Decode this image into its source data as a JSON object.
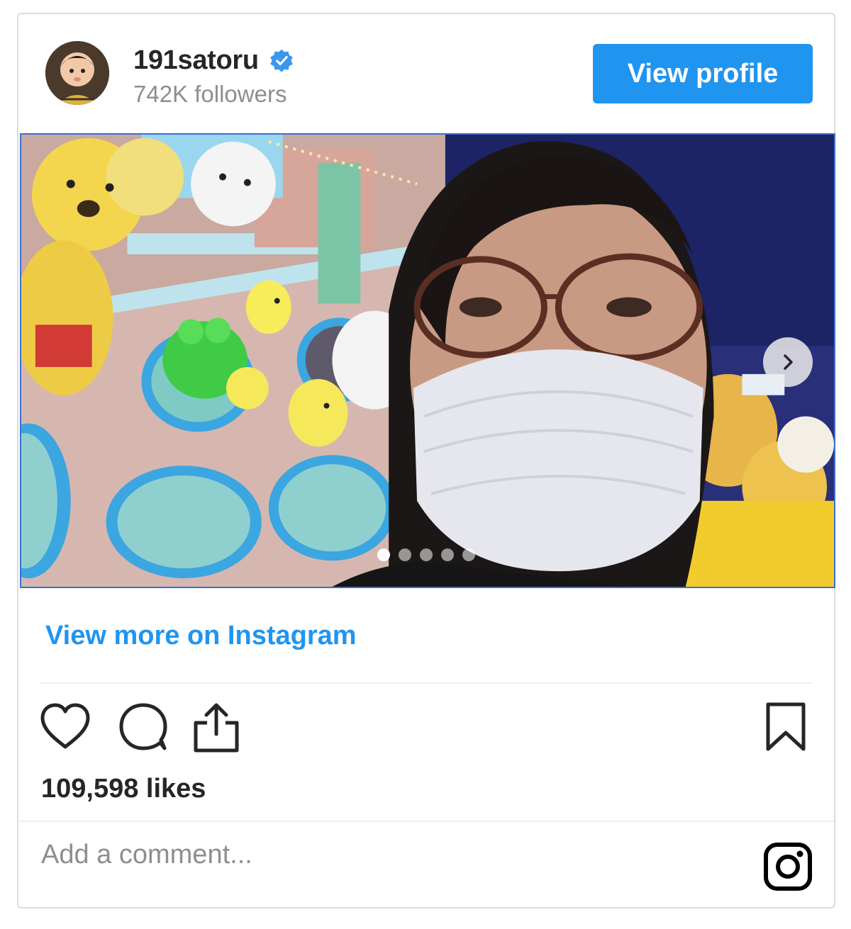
{
  "profile": {
    "username": "191satoru",
    "followers": "742K followers",
    "verified_icon": "verified-badge-icon",
    "view_profile_label": "View profile",
    "accent_color": "#1f95f0"
  },
  "media": {
    "next_icon": "chevron-right-icon",
    "carousel_total": 5,
    "carousel_active": 1
  },
  "post": {
    "view_more_label": "View more on Instagram",
    "likes": "109,598 likes",
    "comment_placeholder": "Add a comment...",
    "action_icons": [
      "heart-icon",
      "comment-icon",
      "share-icon",
      "bookmark-icon"
    ],
    "logo_icon": "instagram-icon"
  }
}
